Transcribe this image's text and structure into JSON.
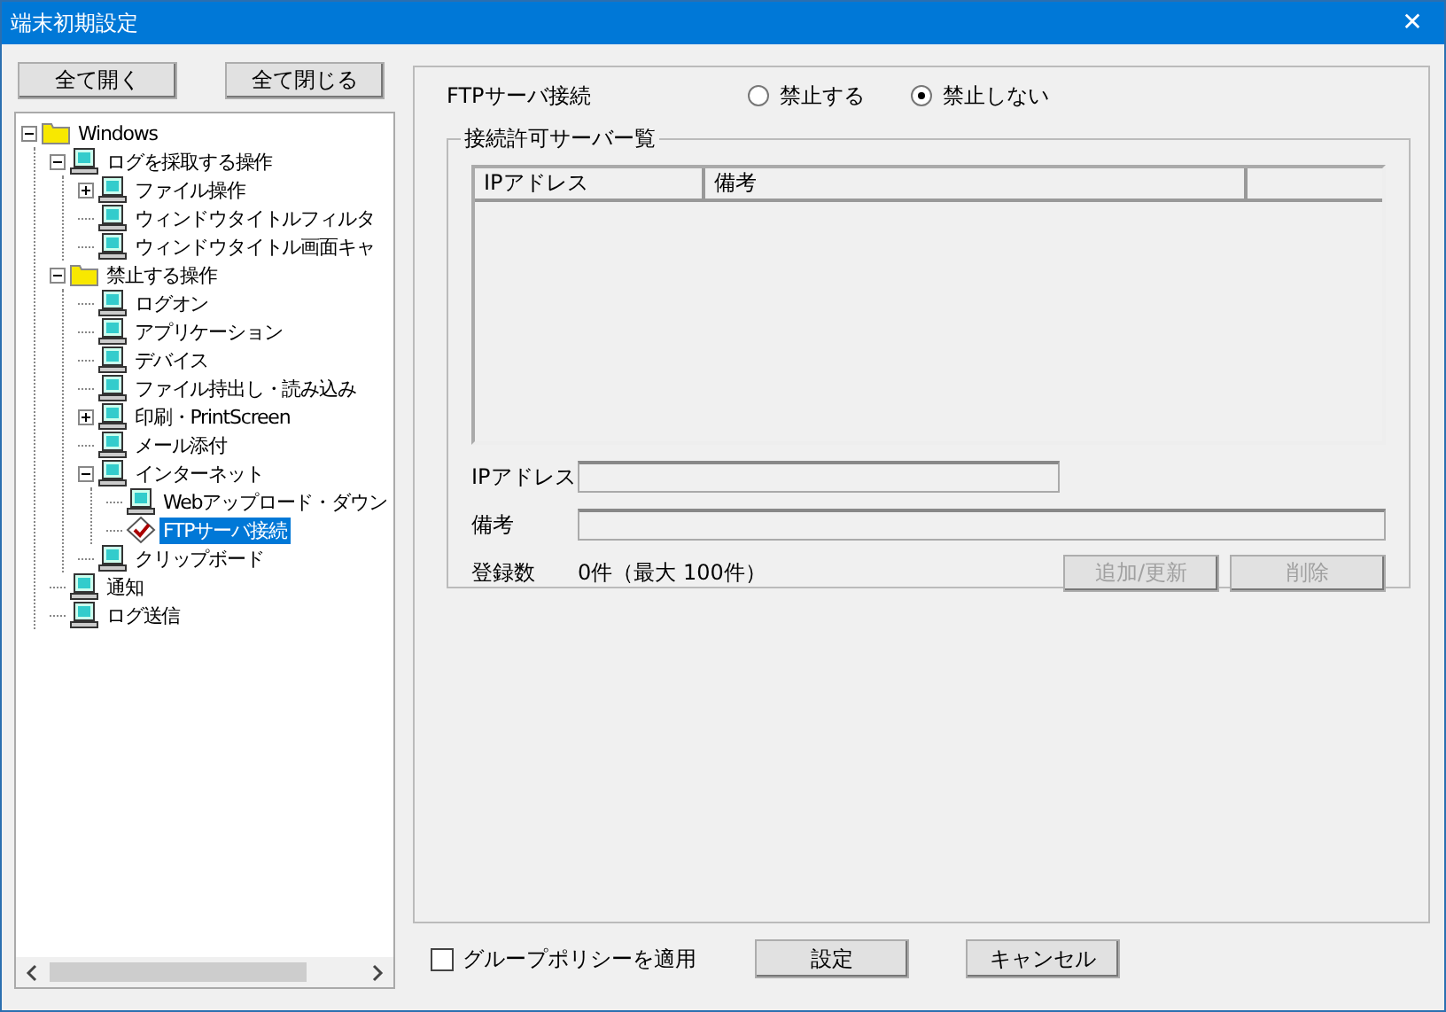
{
  "window": {
    "title": "端末初期設定",
    "close": "✕"
  },
  "tree_buttons": [
    "全て開く",
    "全て閉じる"
  ],
  "tree": [
    {
      "label": "Windows",
      "kind": "folder",
      "expanded": true,
      "selected": false,
      "children": [
        {
          "label": "ログを採取する操作",
          "kind": "computer",
          "expanded": true,
          "selected": false,
          "children": [
            {
              "label": "ファイル操作",
              "kind": "computer",
              "expanded": false,
              "selected": false
            },
            {
              "label": "ウィンドウタイトルフィルタ",
              "kind": "computer",
              "selected": false
            },
            {
              "label": "ウィンドウタイトル画面キャ",
              "kind": "computer",
              "selected": false
            }
          ]
        },
        {
          "label": "禁止する操作",
          "kind": "folder",
          "expanded": true,
          "selected": false,
          "children": [
            {
              "label": "ログオン",
              "kind": "computer",
              "selected": false
            },
            {
              "label": "アプリケーション",
              "kind": "computer",
              "selected": false
            },
            {
              "label": "デバイス",
              "kind": "computer",
              "selected": false
            },
            {
              "label": "ファイル持出し・読み込み",
              "kind": "computer",
              "selected": false
            },
            {
              "label": "印刷・PrintScreen",
              "kind": "computer",
              "expanded": false,
              "selected": false
            },
            {
              "label": "メール添付",
              "kind": "computer",
              "selected": false
            },
            {
              "label": "インターネット",
              "kind": "computer",
              "expanded": true,
              "selected": false,
              "children": [
                {
                  "label": "Webアップロード・ダウン",
                  "kind": "computer",
                  "selected": false
                },
                {
                  "label": "FTPサーバ接続",
                  "kind": "diamond",
                  "selected": true
                }
              ]
            },
            {
              "label": "クリップボード",
              "kind": "computer",
              "selected": false
            }
          ]
        },
        {
          "label": "通知",
          "kind": "computer",
          "selected": false
        },
        {
          "label": "ログ送信",
          "kind": "computer",
          "selected": false
        }
      ]
    }
  ],
  "setting": {
    "label": "FTPサーバ接続",
    "options": [
      {
        "label": "禁止する",
        "selected": false
      },
      {
        "label": "禁止しない",
        "selected": true
      }
    ]
  },
  "group": {
    "title": "接続許可サーバー覧",
    "columns": [
      "IPアドレス",
      "備考"
    ],
    "fields": [
      {
        "label": "IPアドレス",
        "kind": "short"
      },
      {
        "label": "備考",
        "kind": "long"
      }
    ],
    "count_label": "登録数",
    "count": "0件（最大 100件）",
    "buttons": [
      {
        "label": "追加/更新",
        "disabled": true
      },
      {
        "label": "削除",
        "disabled": true
      }
    ]
  },
  "group_policy": {
    "label": "グループポリシーを適用",
    "checked": false
  },
  "buttons": [
    "設定",
    "キャンセル"
  ]
}
